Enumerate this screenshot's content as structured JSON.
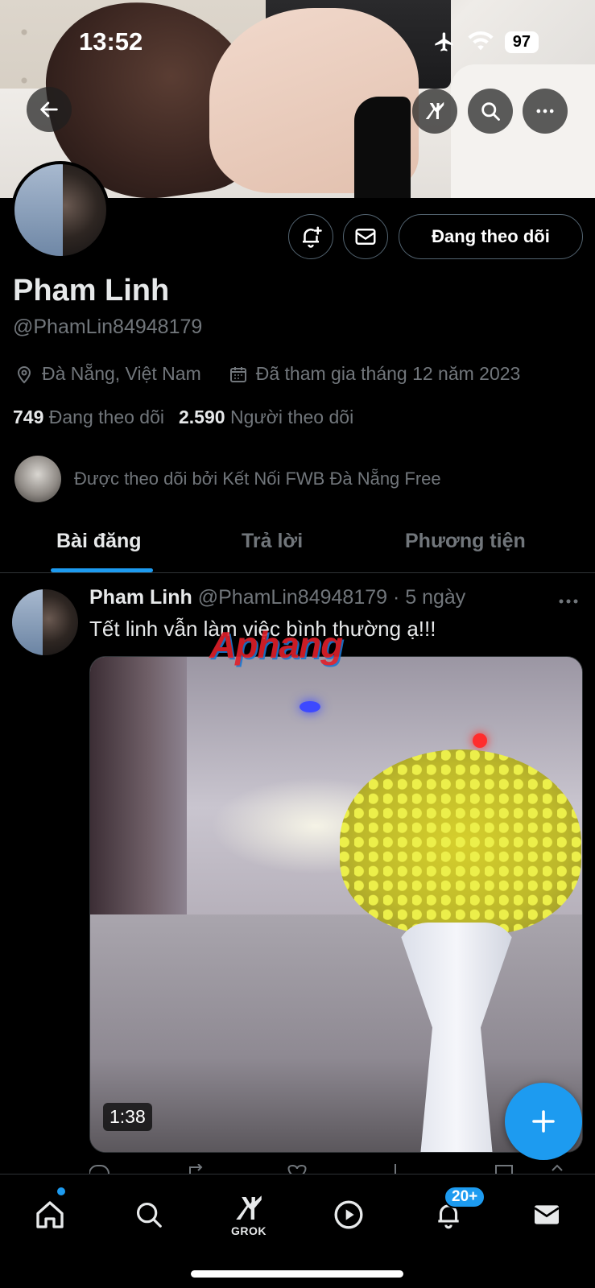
{
  "status_bar": {
    "time": "13:52",
    "battery": "97"
  },
  "profile": {
    "name": "Pham Linh",
    "handle": "@PhamLin84948179",
    "location": "Đà Nẵng, Việt Nam",
    "joined": "Đã tham gia tháng 12 năm 2023",
    "following_count": "749",
    "following_label": "Đang theo dõi",
    "followers_count": "2.590",
    "followers_label": "Người theo dõi",
    "followed_by": "Được theo dõi bởi Kết Nối FWB Đà Nẵng Free",
    "follow_button": "Đang theo dõi"
  },
  "tabs": [
    {
      "label": "Bài đăng",
      "active": true
    },
    {
      "label": "Trả lời",
      "active": false
    },
    {
      "label": "Phương tiện",
      "active": false
    }
  ],
  "post": {
    "name": "Pham Linh",
    "meta": "@PhamLin84948179 · 5 ngày",
    "text": "Tết linh vẫn làm việc bình thường ạ!!!",
    "watermark": "Aphang",
    "video_duration": "1:38"
  },
  "nav": {
    "grok_label": "GROK",
    "notifications_badge": "20+"
  },
  "colors": {
    "accent": "#1d9bf0",
    "text_primary": "#e7e9ea",
    "text_secondary": "#71767b",
    "border": "#2f3336"
  }
}
